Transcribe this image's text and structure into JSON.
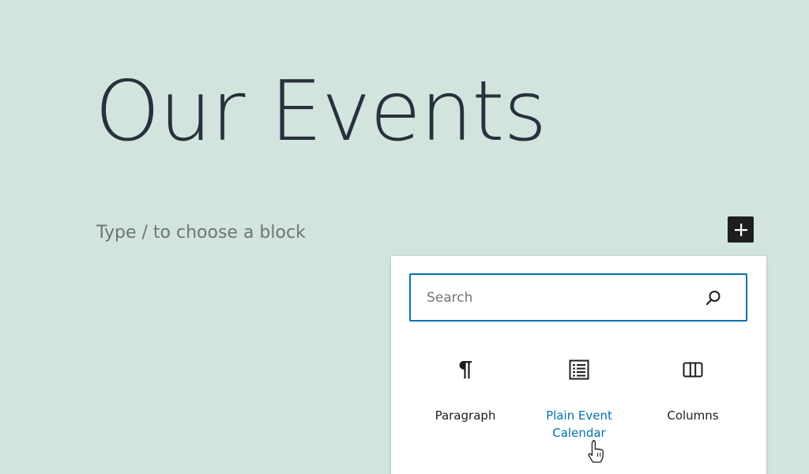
{
  "page": {
    "title": "Our Events",
    "block_placeholder": "Type / to choose a block"
  },
  "inserter": {
    "toggle_icon": "plus-icon",
    "search": {
      "placeholder": "Search",
      "value": "",
      "icon": "search-icon",
      "border_color": "#0073aa"
    },
    "blocks": [
      {
        "label": "Paragraph",
        "icon": "paragraph-icon"
      },
      {
        "label": "Plain Event Calendar",
        "icon": "list-icon",
        "hovered": true
      },
      {
        "label": "Columns",
        "icon": "columns-icon"
      }
    ]
  },
  "colors": {
    "background": "#d1e4dd",
    "title": "#28303d",
    "placeholder": "#6e7478",
    "accent": "#0073aa",
    "dark_button": "#1e1e1e"
  }
}
